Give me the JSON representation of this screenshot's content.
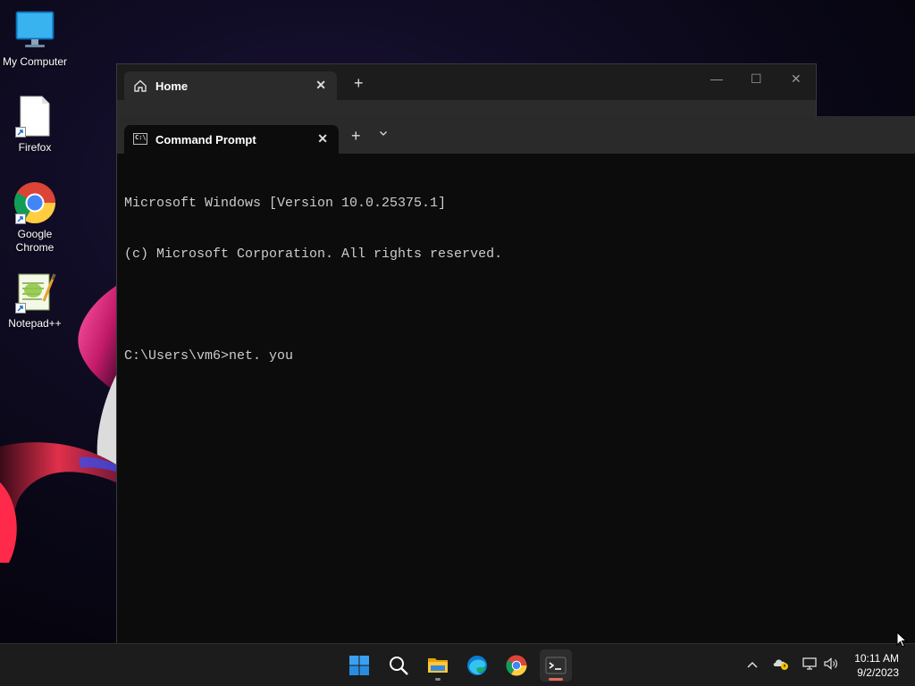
{
  "desktop": {
    "icons": [
      {
        "label": "My Computer"
      },
      {
        "label": "Firefox"
      },
      {
        "label": "Google\nChrome"
      },
      {
        "label": "Notepad++"
      }
    ]
  },
  "explorer": {
    "tab_title": "Home",
    "close_symbol": "✕",
    "new_tab_symbol": "+",
    "minimize_symbol": "—",
    "maximize_symbol": "☐",
    "close_window_symbol": "✕"
  },
  "terminal": {
    "tab_title": "Command Prompt",
    "tab_icon_text": "C:\\",
    "close_symbol": "✕",
    "new_tab_symbol": "+",
    "dropdown_symbol": "⌄",
    "lines": [
      "Microsoft Windows [Version 10.0.25375.1]",
      "(c) Microsoft Corporation. All rights reserved.",
      "",
      "C:\\Users\\vm6>net. you"
    ]
  },
  "taskbar": {
    "apps": [
      {
        "name": "start-button",
        "icon": "windows-logo-icon",
        "active": false
      },
      {
        "name": "search-button",
        "icon": "search-icon",
        "active": false
      },
      {
        "name": "file-explorer-button",
        "icon": "folder-icon",
        "active": false,
        "open": true
      },
      {
        "name": "edge-button",
        "icon": "edge-icon",
        "active": false
      },
      {
        "name": "chrome-button",
        "icon": "chrome-icon",
        "active": false
      },
      {
        "name": "terminal-button",
        "icon": "terminal-icon",
        "active": true,
        "open": true
      }
    ],
    "tray": {
      "chevron": "^",
      "time": "10:11 AM",
      "date": "9/2/2023"
    }
  },
  "colors": {
    "terminal_bg": "#0c0c0c",
    "terminal_text": "#cccccc",
    "taskbar_bg": "#1c1c1c",
    "active_indicator": "#e06a5a"
  }
}
